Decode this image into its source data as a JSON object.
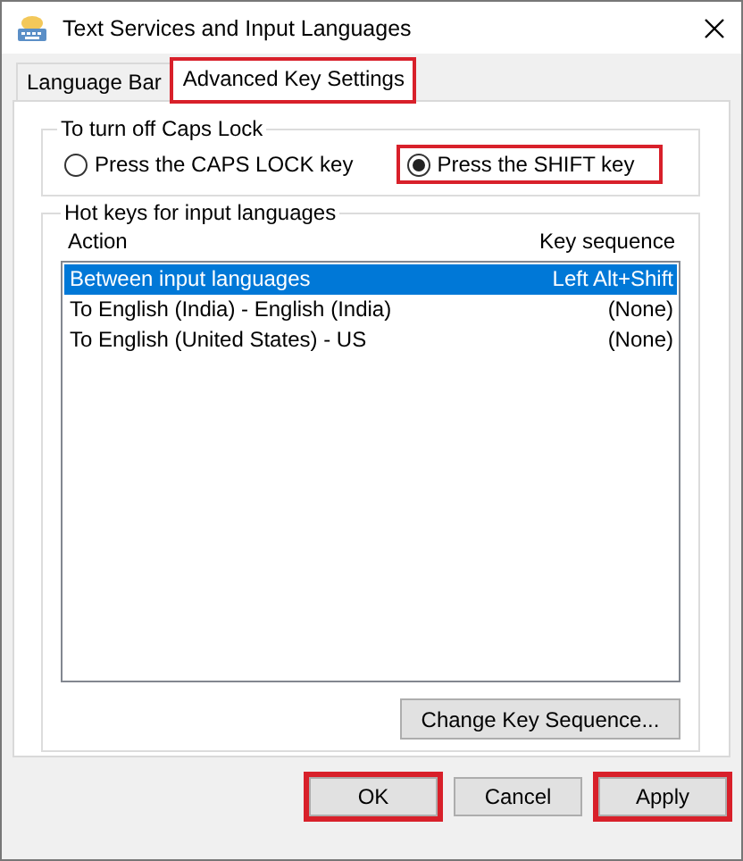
{
  "window": {
    "title": "Text Services and Input Languages"
  },
  "tabs": [
    {
      "label": "Language Bar",
      "selected": false,
      "highlighted": false
    },
    {
      "label": "Advanced Key Settings",
      "selected": true,
      "highlighted": true
    }
  ],
  "caps_lock": {
    "title": "To turn off Caps Lock",
    "options": [
      {
        "label": "Press the CAPS LOCK key",
        "selected": false,
        "highlighted": false
      },
      {
        "label": "Press the SHIFT key",
        "selected": true,
        "highlighted": true
      }
    ]
  },
  "hot_keys": {
    "title": "Hot keys for input languages",
    "columns": [
      "Action",
      "Key sequence"
    ],
    "rows": [
      {
        "action": "Between input languages",
        "key_sequence": "Left Alt+Shift",
        "selected": true
      },
      {
        "action": "To English (India) - English (India)",
        "key_sequence": "(None)",
        "selected": false
      },
      {
        "action": "To English (United States) - US",
        "key_sequence": "(None)",
        "selected": false
      }
    ],
    "button": "Change Key Sequence..."
  },
  "buttons": [
    {
      "label": "OK",
      "highlighted": true
    },
    {
      "label": "Cancel",
      "highlighted": false
    },
    {
      "label": "Apply",
      "highlighted": true
    }
  ]
}
